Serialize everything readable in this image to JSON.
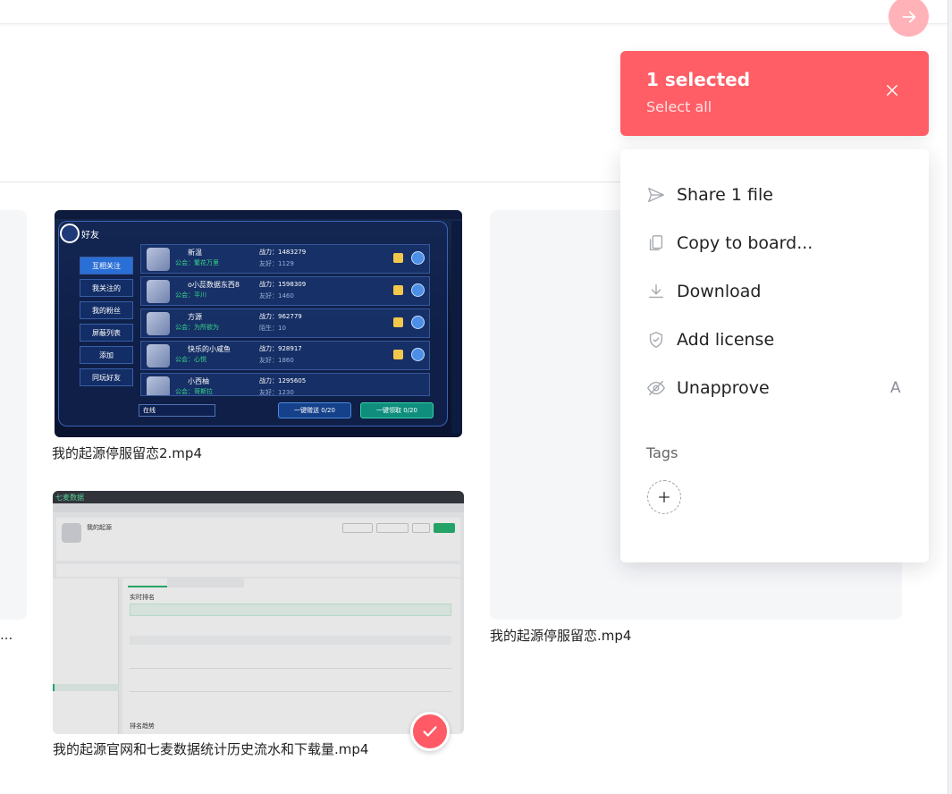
{
  "selection": {
    "count_label": "1 selected",
    "select_all_label": "Select all"
  },
  "actions": [
    {
      "label": "Share 1 file",
      "icon": "send-icon",
      "shortcut": ""
    },
    {
      "label": "Copy to board...",
      "icon": "copy-icon",
      "shortcut": ""
    },
    {
      "label": "Download",
      "icon": "download-icon",
      "shortcut": ""
    },
    {
      "label": "Add license",
      "icon": "shield-check-icon",
      "shortcut": ""
    },
    {
      "label": "Unapprove",
      "icon": "eye-off-icon",
      "shortcut": "A"
    }
  ],
  "tags": {
    "label": "Tags"
  },
  "files": [
    {
      "name": "我的起源停服留恋2.mp4"
    },
    {
      "name": "我的起源官网和七麦数据统计历史流水和下载量.mp4",
      "selected": true
    },
    {
      "name": "我的起源停服留恋.mp4"
    }
  ],
  "truncated_left_caption": "...",
  "game_thumb": {
    "title": "好友",
    "menu": [
      "互相关注",
      "我关注的",
      "我的粉丝",
      "屏蔽列表",
      "添加",
      "同玩好友"
    ],
    "rows": [
      {
        "name": "新温",
        "guild": "公会：繁花万里",
        "power": "战力：1483279",
        "favor": "友好：1129"
      },
      {
        "name": "o小蕊数据东西8",
        "guild": "公会：平川",
        "power": "战力：1598309",
        "favor": "友好：1460"
      },
      {
        "name": "方源",
        "guild": "公会：为所欲为",
        "power": "战力：962779",
        "favor": "陌生：10"
      },
      {
        "name": "快乐的小咸鱼",
        "guild": "公会：心悦",
        "power": "战力：928917",
        "favor": "友好：1860"
      },
      {
        "name": "小西柚",
        "guild": "公会：哥斯拉",
        "power": "战力：1295605",
        "favor": "友好：1230"
      }
    ],
    "status": "在线",
    "btn_send": "一键赠送 0/20",
    "btn_get": "一键领取 0/20"
  },
  "web_thumb": {
    "brand": "七麦数据",
    "app_name": "我的起源",
    "section_title": "实时排名",
    "sub_title": "排名趋势"
  },
  "colors": {
    "accent": "#ff5e66",
    "accent_soft": "#ffb3b8",
    "go_button": "#ffb3b8"
  }
}
